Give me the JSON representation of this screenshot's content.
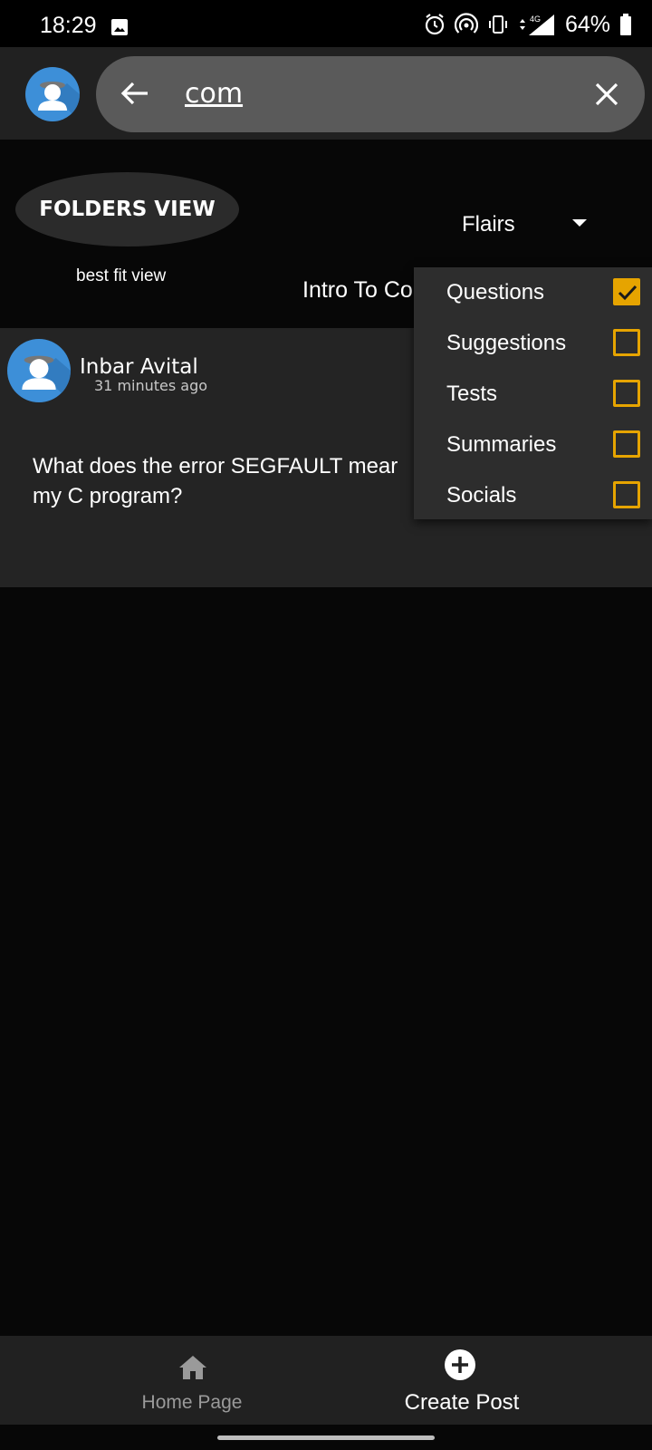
{
  "status_bar": {
    "time": "18:29",
    "network": "4G",
    "battery": "64%"
  },
  "search": {
    "query": "com"
  },
  "controls": {
    "folders_view_label": "FOLDERS VIEW",
    "best_fit_label": "best fit view",
    "flairs_label": "Flairs",
    "course_label": "Intro To Co"
  },
  "post": {
    "author": "Inbar Avital",
    "time": "31 minutes ago",
    "text_line1": "What does the error SEGFAULT mear",
    "text_line2": "my C program?"
  },
  "flairs_menu": {
    "items": [
      {
        "label": "Questions",
        "checked": true
      },
      {
        "label": "Suggestions",
        "checked": false
      },
      {
        "label": "Tests",
        "checked": false
      },
      {
        "label": "Summaries",
        "checked": false
      },
      {
        "label": "Socials",
        "checked": false
      }
    ]
  },
  "bottom_nav": {
    "home_label": "Home Page",
    "create_label": "Create Post"
  },
  "colors": {
    "accent": "#e6a400",
    "avatar_blue": "#3d8fd8",
    "card_bg": "#242424"
  }
}
